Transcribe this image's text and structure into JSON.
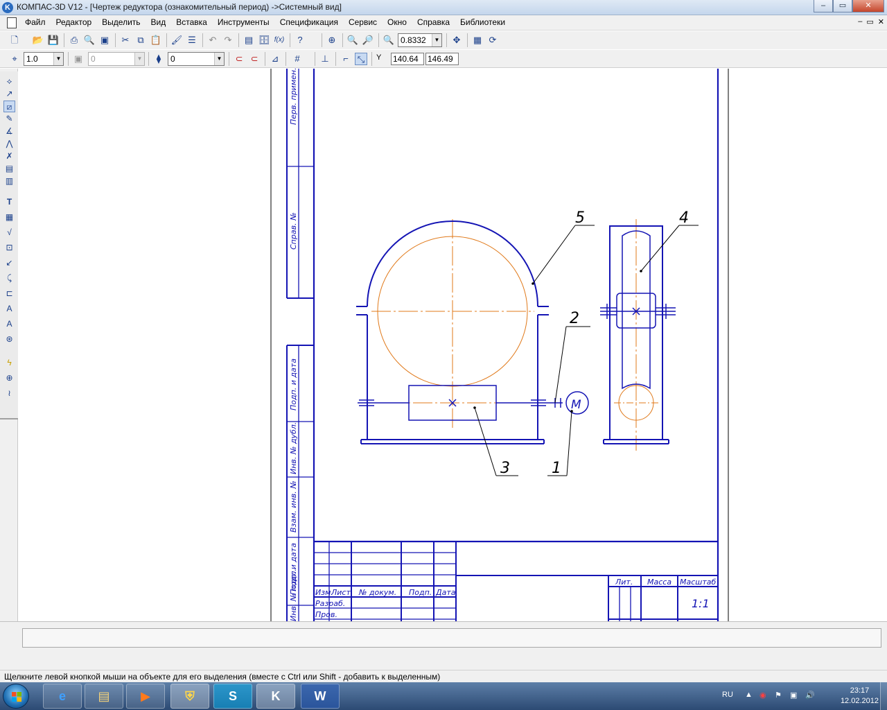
{
  "window": {
    "title": "КОМПАС-3D V12 - [Чертеж редуктора (ознакомительный период) ->Системный вид]",
    "app_icon": "K"
  },
  "window_buttons": {
    "minimize": "–",
    "maximize": "▭",
    "close": "✕"
  },
  "menu": {
    "items": [
      "Файл",
      "Редактор",
      "Выделить",
      "Вид",
      "Вставка",
      "Инструменты",
      "Спецификация",
      "Сервис",
      "Окно",
      "Справка",
      "Библиотеки"
    ],
    "mdi_buttons": [
      "–",
      "▭",
      "✕"
    ]
  },
  "toolbar1": {
    "zoom_value": "0.8332"
  },
  "toolbar2": {
    "step_value": "1.0",
    "layer_value": "0",
    "style_value": "0",
    "coord_label": "Y",
    "coord_x": "140.64",
    "coord_y": "146.49"
  },
  "drawing": {
    "side_stamp_labels": [
      "Перв. примен.",
      "Справ. №",
      "Подп. и дата",
      "Инв. № дубл.",
      "Взам. инв. №",
      "Подп. и дата",
      "Инв. № подл."
    ],
    "title_block": {
      "headers": [
        "Изм.",
        "Лист",
        "№ докум.",
        "Подп.",
        "Дата"
      ],
      "rows": [
        "Разраб.",
        "Пров."
      ],
      "lit_label": "Лит.",
      "mass_label": "Масса",
      "scale_label": "Масштаб",
      "scale_value": "1:1"
    },
    "callouts": [
      "1",
      "2",
      "3",
      "4",
      "5"
    ],
    "motor_label": "М"
  },
  "status": {
    "text": "Щелкните левой кнопкой мыши на объекте для его выделения (вместе с Ctrl или Shift - добавить к выделенным)"
  },
  "taskbar": {
    "apps": [
      "explorer",
      "media-player",
      "security-center",
      "skype",
      "kompas",
      "word"
    ],
    "language": "RU",
    "time": "23:17",
    "date": "12.02.2012"
  },
  "colors": {
    "drawing_line": "#1414b4",
    "axis_line": "#e07818",
    "canvas_bg": "#ffffff"
  }
}
